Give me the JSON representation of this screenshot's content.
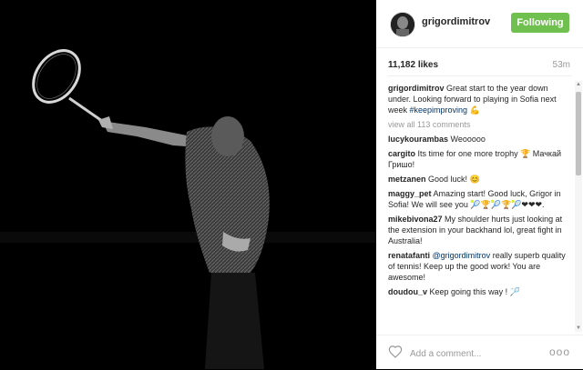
{
  "post": {
    "username": "grigordimitrov",
    "follow_label": "Following",
    "likes": "11,182 likes",
    "time": "53m",
    "caption_user": "grigordimitrov",
    "caption_text": "Great start to the year down under. Looking forward to playing in Sofia next week",
    "caption_tag": "#keepimproving",
    "caption_emoji": "💪",
    "view_all": "view all 113 comments"
  },
  "comments": [
    {
      "user": "lucykourambas",
      "text": "Weooooo"
    },
    {
      "user": "cargito",
      "text": "Its time for one more trophy 🏆 Мачкай Гришо!"
    },
    {
      "user": "metzanen",
      "text": "Good luck! 😊"
    },
    {
      "user": "maggy_pet",
      "text": "Amazing start! Good luck, Grigor in Sofia! We will see you 🎾🏆🎾🏆🎾❤❤❤."
    },
    {
      "user": "mikebivona27",
      "text": "My shoulder hurts just looking at the extension in your backhand lol, great fight in Australia!"
    },
    {
      "user": "renatafanti",
      "mention": "@grigordimitrov",
      "text": "really superb quality of tennis! Keep up the good work! You are awesome!"
    },
    {
      "user": "doudou_v",
      "text": "Keep going this way ! 🏸"
    }
  ],
  "footer": {
    "add_comment_placeholder": "Add a comment...",
    "more_label": "ooo"
  },
  "colors": {
    "follow_bg": "#70c050",
    "photo_bg": "#000000",
    "link": "#003569"
  },
  "icons": {
    "like": "heart-icon",
    "more": "more-options-icon",
    "scroll_up": "scroll-up-arrow-icon",
    "scroll_down": "scroll-down-arrow-icon"
  }
}
